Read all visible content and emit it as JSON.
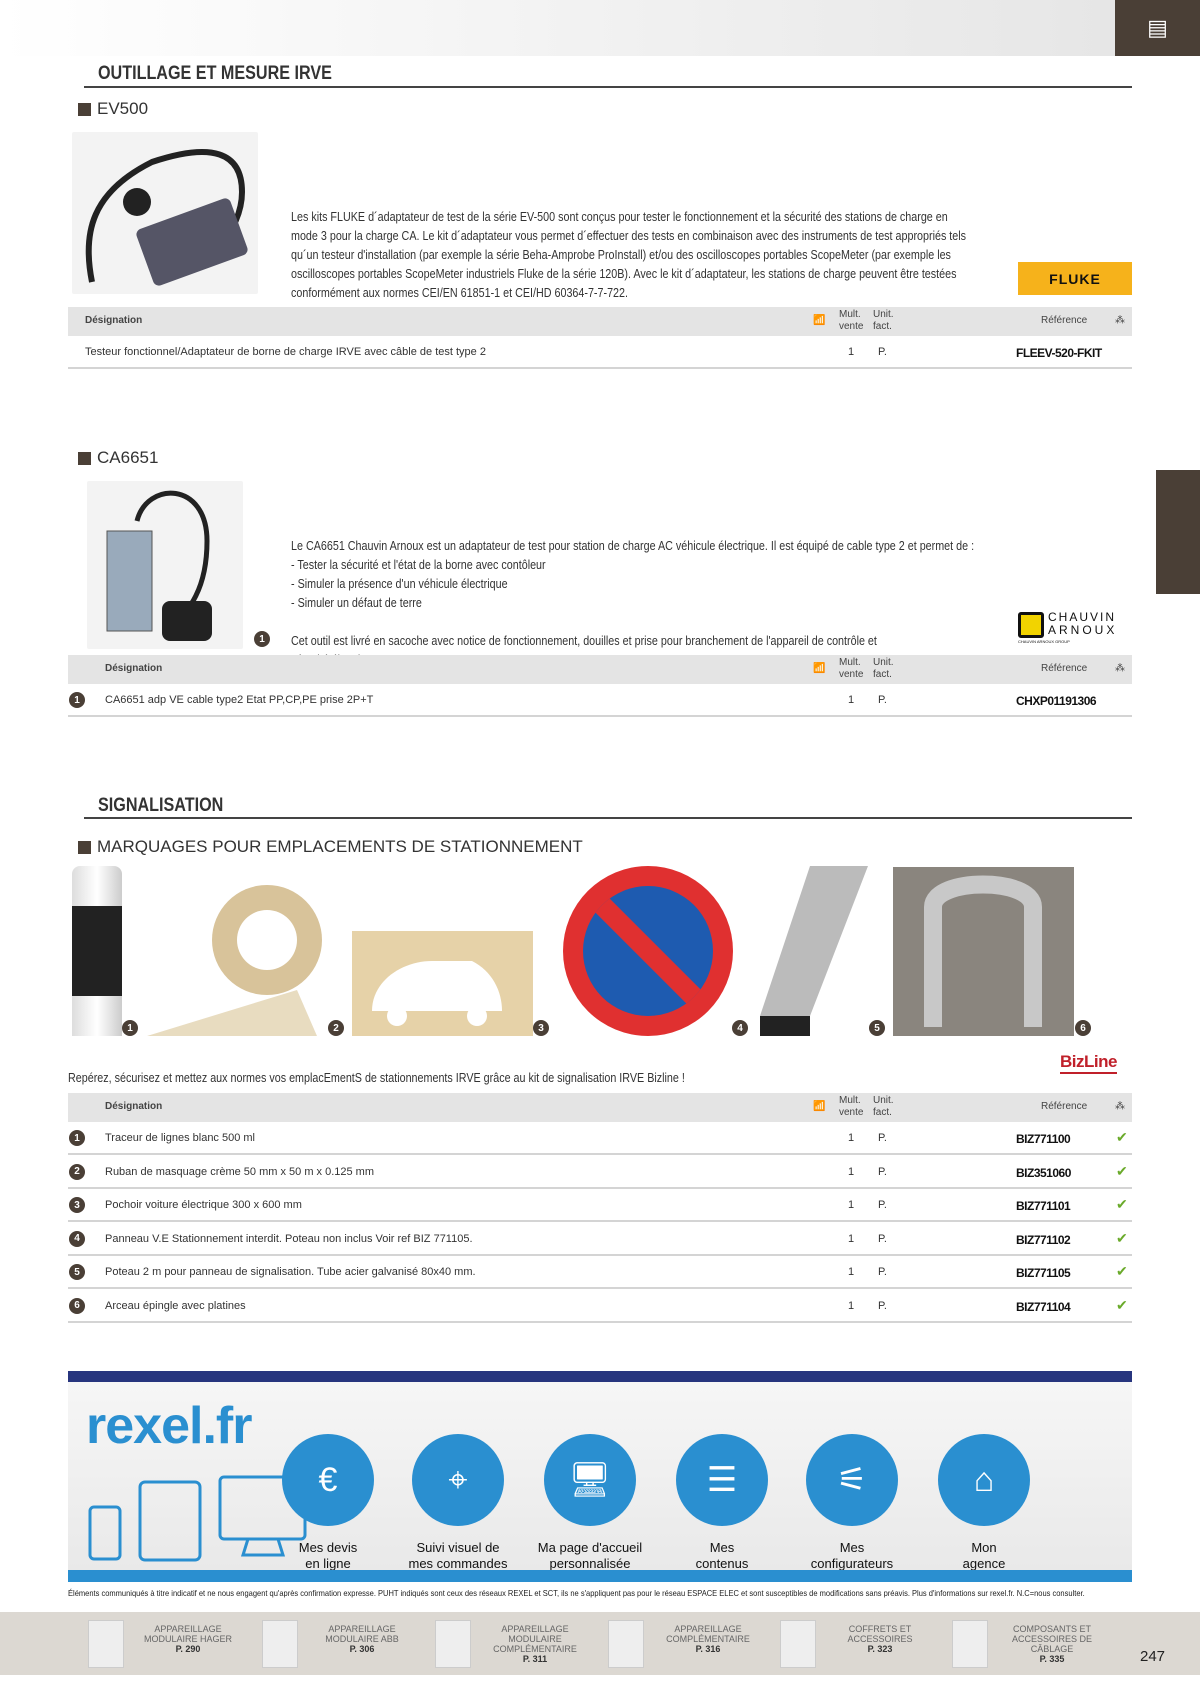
{
  "header": {
    "tab_icon": "catalog-icon"
  },
  "section1": {
    "title": "OUTILLAGE ET MESURE IRVE"
  },
  "ev500": {
    "heading": "EV500",
    "description": [
      "Les kits FLUKE d´adaptateur de test de la série EV-500 sont conçus pour tester le fonctionnement et la sécurité des stations de charge en",
      "mode 3 pour la charge CA. Le kit d´adaptateur vous permet d´effectuer des tests en combinaison avec des instruments de test appropriés tels",
      "qu´un testeur d'installation (par exemple la série Beha-Amprobe ProInstall) et/ou des oscilloscopes portables ScopeMeter (par exemple les",
      "oscilloscopes portables ScopeMeter industriels Fluke de la série 120B). Avec le kit d´adaptateur, les stations de charge peuvent être testées",
      "conformément aux normes CEI/EN 61851-1 et CEI/HD 60364-7-7-722."
    ],
    "brand": "FLUKE",
    "rows": [
      {
        "designation": "Testeur fonctionnel/Adaptateur de borne de charge IRVE avec câble de test type 2",
        "mult": "1",
        "unit": "P.",
        "ref": "FLEEV-520-FKIT"
      }
    ]
  },
  "table_header": {
    "designation": "Désignation",
    "mult1": "Mult.",
    "mult2": "vente",
    "unit1": "Unit.",
    "unit2": "fact.",
    "reference": "Référence"
  },
  "ca6651": {
    "heading": "CA6651",
    "description": [
      "Le CA6651 Chauvin Arnoux est un adaptateur de test pour station de charge AC véhicule électrique. Il est équipé de cable type 2 et permet de :",
      "- Tester la sécurité et l'état de la borne avec contôleur",
      "- Simuler la présence d'un véhicule électrique",
      "- Simuler un défaut de terre"
    ],
    "note_num": "1",
    "note": "Cet outil est livré en sacoche avec notice de fonctionnement, douilles et prise pour branchement de l'appareil de contrôle et sécurité électrique.",
    "brand1": "CHAUVIN",
    "brand2": "ARNOUX",
    "brand3": "CHAUVIN ARNOUX GROUP",
    "rows": [
      {
        "num": "1",
        "designation": "CA6651 adp VE cable type2 Etat PP,CP,PE prise 2P+T",
        "mult": "1",
        "unit": "P.",
        "ref": "CHXP01191306"
      }
    ]
  },
  "section2": {
    "title": "SIGNALISATION",
    "sub": "MARQUAGES POUR EMPLACEMENTS DE STATIONNEMENT",
    "image_nums": [
      "1",
      "2",
      "3",
      "4",
      "5",
      "6"
    ],
    "brand": "BizLine",
    "intro": "Repérez, sécurisez et mettez aux normes vos emplacEmentS de stationnements IRVE grâce au kit de signalisation IRVE Bizline !",
    "rows": [
      {
        "num": "1",
        "designation": "Traceur de lignes blanc 500 ml",
        "mult": "1",
        "unit": "P.",
        "ref": "BIZ771100",
        "check": "✔"
      },
      {
        "num": "2",
        "designation": "Ruban de masquage crème 50 mm x 50 m x 0.125 mm",
        "mult": "1",
        "unit": "P.",
        "ref": "BIZ351060",
        "check": "✔"
      },
      {
        "num": "3",
        "designation": "Pochoir voiture électrique 300 x 600 mm",
        "mult": "1",
        "unit": "P.",
        "ref": "BIZ771101",
        "check": "✔"
      },
      {
        "num": "4",
        "designation": "Panneau V.E Stationnement interdit. Poteau non inclus Voir ref BIZ 771105.",
        "mult": "1",
        "unit": "P.",
        "ref": "BIZ771102",
        "check": "✔"
      },
      {
        "num": "5",
        "designation": "Poteau 2 m pour panneau de signalisation. Tube acier galvanisé 80x40 mm.",
        "mult": "1",
        "unit": "P.",
        "ref": "BIZ771105",
        "check": "✔"
      },
      {
        "num": "6",
        "designation": "Arceau épingle avec platines",
        "mult": "1",
        "unit": "P.",
        "ref": "BIZ771104",
        "check": "✔"
      }
    ]
  },
  "banner": {
    "logo": "rexel.fr",
    "services": [
      {
        "label1": "Mes devis",
        "label2": "en ligne",
        "icon": "quote-euro-icon"
      },
      {
        "label1": "Suivi visuel de",
        "label2": "mes commandes",
        "icon": "tracking-icon"
      },
      {
        "label1": "Ma page d'accueil",
        "label2": "personnalisée",
        "icon": "homepage-icon"
      },
      {
        "label1": "Mes",
        "label2": "contenus",
        "icon": "content-icon"
      },
      {
        "label1": "Mes",
        "label2": "configurateurs",
        "icon": "sliders-icon"
      },
      {
        "label1": "Mon",
        "label2": "agence",
        "icon": "agency-icon"
      }
    ],
    "colors": {
      "blue": "#2a8fd0",
      "dark": "#27357e"
    }
  },
  "disclaimer": "Éléments communiqués à titre indicatif et ne nous engagent qu'après confirmation expresse. PUHT indiqués sont ceux des réseaux REXEL et SCT, ils ne s'appliquent pas pour le réseau ESPACE ELEC et sont susceptibles de modifications sans préavis. Plus d'informations sur rexel.fr. N.C=nous consulter.",
  "footer": {
    "categories": [
      {
        "label": "APPAREILLAGE MODULAIRE HAGER",
        "page": "P. 290"
      },
      {
        "label": "APPAREILLAGE MODULAIRE ABB",
        "page": "P. 306"
      },
      {
        "label": "APPAREILLAGE MODULAIRE COMPLÉMENTAIRE",
        "page": "P. 311"
      },
      {
        "label": "APPAREILLAGE COMPLÉMENTAIRE",
        "page": "P. 316"
      },
      {
        "label": "COFFRETS ET ACCESSOIRES",
        "page": "P. 323"
      },
      {
        "label": "COMPOSANTS ET ACCESSOIRES DE CÂBLAGE",
        "page": "P. 335"
      }
    ],
    "page_number": "247"
  }
}
